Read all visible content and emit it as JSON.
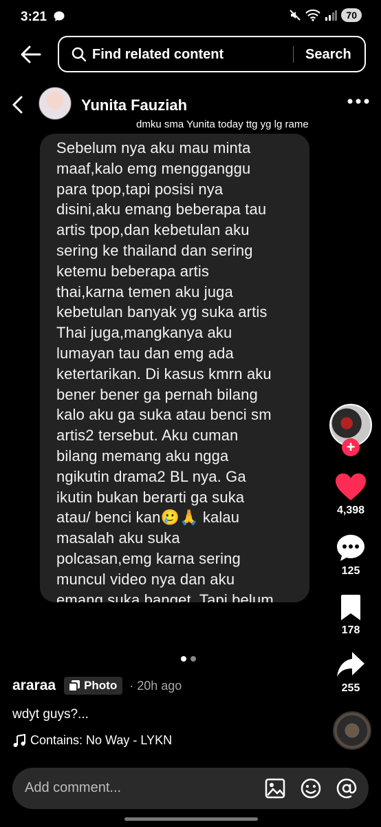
{
  "status_bar": {
    "time": "3:21",
    "battery": "70"
  },
  "search": {
    "placeholder": "Find related content",
    "button_label": "Search"
  },
  "dm": {
    "contact_name": "Yunita Fauziah",
    "caption_overlay": "dmku sma Yunita today ttg yg lg rame",
    "message": "Sebelum nya aku mau minta\nmaaf,kalo emg mengganggu\npara tpop,tapi posisi nya\ndisini,aku emang beberapa tau\nartis tpop,dan kebetulan aku\nsering ke thailand dan sering\nketemu beberapa artis\nthai,karna temen aku juga\nkebetulan banyak yg suka artis\nThai juga,mangkanya aku\nlumayan tau dan emg ada\nketertarikan. Di kasus kmrn aku\nbener bener ga pernah bilang\nkalo aku ga suka atau benci sm\nartis2 tersebut. Aku cuman\nbilang memang aku ngga\nngikutin drama2 BL nya. Ga\nikutin bukan berarti ga suka\natau/ benci kan🥲🙏 kalau\nmasalah aku suka\npolcasan,emg karna sering\nmuncul video nya dan aku\nemang suka banget. Tapi belum"
  },
  "pagination": {
    "total": 2,
    "current": 1
  },
  "actions": {
    "likes": "4,398",
    "comments": "125",
    "saves": "178",
    "shares": "255",
    "like_color": "#fe2c55"
  },
  "post": {
    "author": "araraa",
    "badge": "Photo",
    "time": "· 20h ago",
    "caption": "wdyt guys?...",
    "music": "Contains: No Way - LYKN"
  },
  "comment": {
    "placeholder": "Add comment..."
  },
  "icons": [
    "back-arrow-icon",
    "search-icon",
    "chevron-left-icon",
    "more-icon",
    "heart-icon",
    "comment-icon",
    "bookmark-icon",
    "share-icon",
    "photo-icon",
    "music-note-icon",
    "image-icon",
    "emoji-icon",
    "mention-icon"
  ]
}
